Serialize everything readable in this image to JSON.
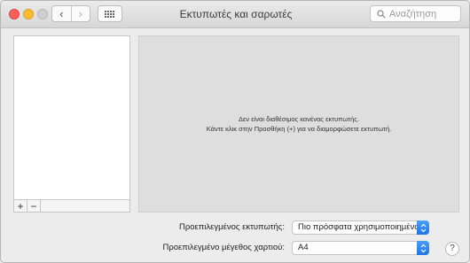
{
  "window": {
    "title": "Εκτυπωτές και σαρωτές"
  },
  "toolbar": {
    "back_glyph": "‹",
    "forward_glyph": "›",
    "search_placeholder": "Αναζήτηση",
    "icons": {
      "back": "chevron-left-icon",
      "forward": "chevron-right-icon",
      "show_all": "grid-icon",
      "search": "search-icon"
    }
  },
  "printers": {
    "items": [],
    "add_label": "+",
    "remove_label": "−"
  },
  "detail": {
    "line1": "Δεν είναι διαθέσιμος κανένας εκτυπωτής.",
    "line2": "Κάντε κλικ στην Προσθήκη (+) για να διαμορφώσετε εκτυπωτή."
  },
  "settings": {
    "default_printer_label": "Προεπιλεγμένος εκτυπωτής:",
    "default_printer_value": "Πιο πρόσφατα χρησιμοποιημένος",
    "paper_size_label": "Προεπιλεγμένο μέγεθος χαρτιού:",
    "paper_size_value": "A4"
  },
  "help_label": "?",
  "colors": {
    "accent": "#2b82ea",
    "close": "#fc5f57",
    "minimize": "#fdbc2e"
  }
}
